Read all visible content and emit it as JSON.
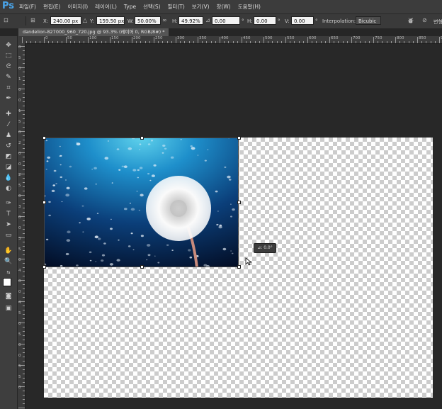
{
  "app": {
    "logo": "Ps"
  },
  "menu": [
    "파일(F)",
    "편집(E)",
    "이미지(I)",
    "레이어(L)",
    "Type",
    "선택(S)",
    "필터(T)",
    "보기(V)",
    "창(W)",
    "도움말(H)"
  ],
  "options": {
    "x_label": "X:",
    "x_value": "240.00 px",
    "y_label": "Y:",
    "y_value": "159.50 px",
    "w_label": "W:",
    "w_value": "50.00%",
    "h_label": "H:",
    "h_value": "49.92%",
    "rotate_value": "0.00",
    "hskew_label": "H:",
    "hskew_value": "0.00",
    "vskew_label": "V:",
    "vskew_value": "0.00",
    "interp_label": "Interpolation:",
    "interp_value": "Bicubic",
    "right_label": "변형"
  },
  "document": {
    "tab_title": "dandelion-827000_960_720.jpg @ 93.3% (레이어 0, RGB/8#) *"
  },
  "ruler_h": [
    "0",
    "50",
    "100",
    "150",
    "200",
    "250",
    "300",
    "350",
    "400",
    "450",
    "500",
    "550",
    "600",
    "650",
    "700",
    "750",
    "800",
    "850",
    "900"
  ],
  "ruler_v": [
    "0",
    "5",
    "0",
    "1",
    "0",
    "0",
    "1",
    "5",
    "0",
    "2",
    "0",
    "0",
    "2",
    "5",
    "0",
    "3",
    "0",
    "0",
    "3",
    "5",
    "0",
    "4",
    "0",
    "0",
    "4",
    "5",
    "0",
    "5",
    "0",
    "0",
    "5",
    "5",
    "0"
  ],
  "tooltip": {
    "angle": "⊿: 0.0°"
  },
  "colors": {
    "accent": "#4aa5ea",
    "bg": "#282828",
    "panel": "#3c3c3c"
  }
}
